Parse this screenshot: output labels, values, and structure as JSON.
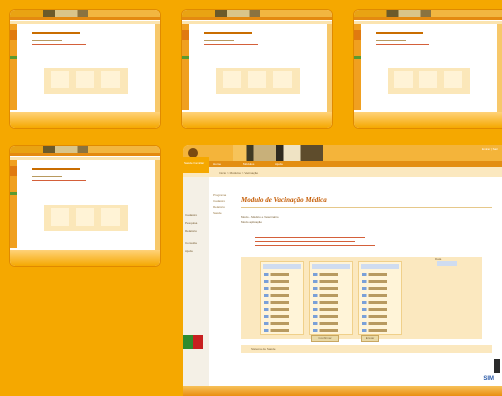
{
  "main_window": {
    "module_title": "Modulo de Vacinação Médica",
    "intro_line_1": "Modo - Médico e Veterinário",
    "intro_line_2": "Modo aplicação",
    "breadcrumb": "Início > Módulos > Vacinação",
    "nav_items": [
      "Home",
      "Módulos",
      "Ajuda"
    ],
    "top_links": "Entrar | Sair",
    "sidebar_heading": "Saúde Familiar",
    "sidebar_items": [
      "Cadastro",
      "Pesquisa",
      "Relatório",
      "Consulta",
      "Ajuda"
    ],
    "subnav_items": [
      "Programa",
      "Cadastro",
      "Relatório",
      "Saúde"
    ],
    "field_label": "Data",
    "confirm_label": "Confirmar",
    "submit_label": "Enviar",
    "footer_text": "Sistema de Saúde",
    "sim_logo": "SIM"
  },
  "colors": {
    "background": "#F5A800",
    "accent": "#E38E12",
    "title": "#C45A00",
    "green": "#2E8B2E",
    "red": "#C72020"
  }
}
